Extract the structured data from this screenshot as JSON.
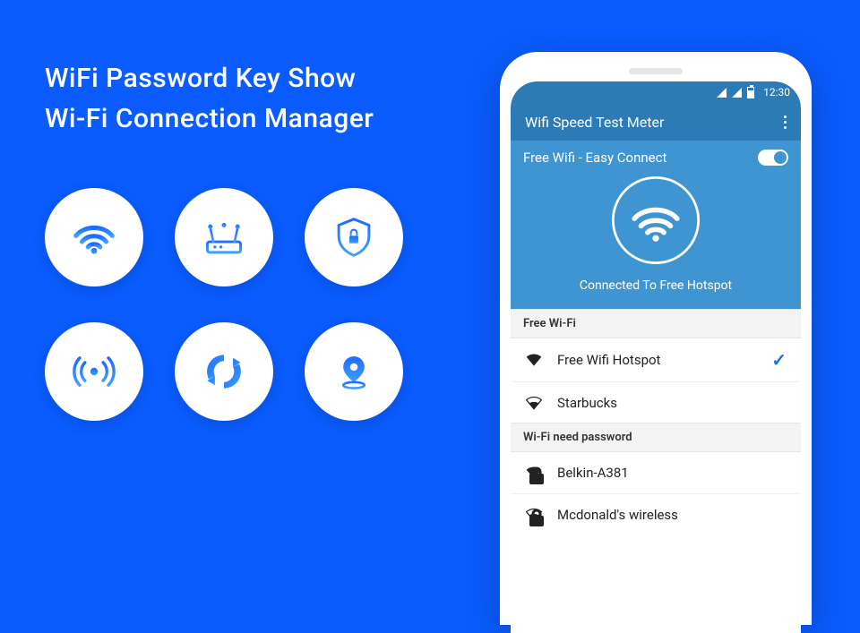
{
  "headline": {
    "line1": "WiFi Password Key Show",
    "line2": "Wi-Fi Connection Manager"
  },
  "feature_icons": {
    "wifi": "wifi-icon",
    "router": "router-icon",
    "shield": "shield-lock-icon",
    "antenna": "antenna-icon",
    "refresh": "refresh-icon",
    "location": "location-pin-icon"
  },
  "phone": {
    "status": {
      "time": "12:30"
    },
    "appbar": {
      "title": "Wifi Speed Test Meter"
    },
    "hero": {
      "subtitle": "Free Wifi - Easy Connect",
      "status": "Connected To Free Hotspot"
    },
    "sections": {
      "free": {
        "header": "Free Wi-Fi",
        "items": [
          {
            "name": "Free Wifi Hotspot",
            "selected": true
          },
          {
            "name": "Starbucks",
            "selected": false
          }
        ]
      },
      "locked": {
        "header": "Wi-Fi need password",
        "items": [
          {
            "name": "Belkin-A381"
          },
          {
            "name": "Mcdonald's wireless"
          }
        ]
      }
    }
  }
}
